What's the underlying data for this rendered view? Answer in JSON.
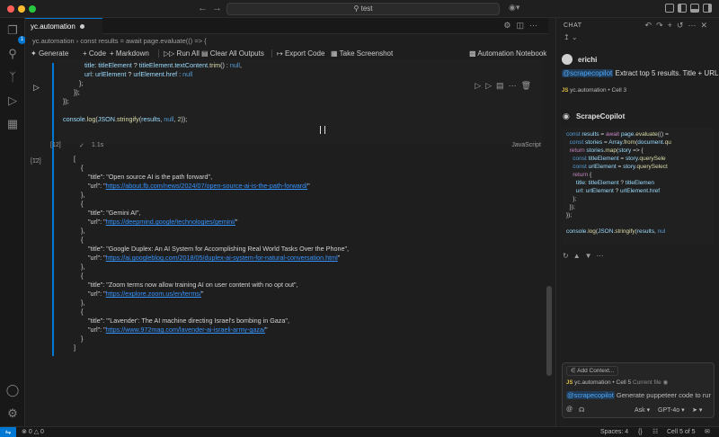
{
  "titlebar": {
    "search_text": "test",
    "colors": {
      "close": "#ff5f57",
      "minimize": "#febc2e",
      "maximize": "#28c840"
    }
  },
  "activity": {
    "items": [
      "explorer-icon",
      "search-icon",
      "source-control-icon",
      "run-debug-icon",
      "extensions-icon"
    ],
    "explorer_badge": "1"
  },
  "editor": {
    "tab": {
      "label": "yc.automation"
    },
    "breadcrumb": [
      "yc.automation",
      "const results = await page.evaluate(() => {"
    ],
    "toolbar": {
      "generate": "Generate",
      "code": "Code",
      "markdown": "Markdown",
      "run_all": "Run All",
      "clear_outputs": "Clear All Outputs",
      "export": "Export Code",
      "screenshot": "Take Screenshot",
      "notebook": "Automation Notebook"
    },
    "code_lines": [
      "title: titleElement ? titleElement.textContent.trim() : null,",
      "url: urlElement ? urlElement.href : null",
      "};",
      "});",
      "});",
      "",
      "console.log(JSON.stringify(results, null, 2));"
    ],
    "cell": {
      "exec_count": "[12]",
      "duration": "1.1s",
      "language": "JavaScript"
    },
    "output": {
      "results": [
        {
          "title": "Open source AI is the path forward",
          "url": "https://about.fb.com/news/2024/07/open-source-ai-is-the-path-forward/"
        },
        {
          "title": "Gemini AI",
          "url": "https://deepmind.google/technologies/gemini/"
        },
        {
          "title": "Google Duplex: An AI System for Accomplishing Real World Tasks Over the Phone",
          "url": "https://ai.googleblog.com/2018/05/duplex-ai-system-for-natural-conversation.html"
        },
        {
          "title": "Zoom terms now allow training AI on user content with no opt out",
          "url": "https://explore.zoom.us/en/terms/"
        },
        {
          "title": "'Lavender': The AI machine directing Israel's bombing in Gaza",
          "url": "https://www.972mag.com/lavender-ai-israeli-army-gaza/"
        }
      ]
    }
  },
  "chat": {
    "header": "CHAT",
    "user": {
      "name": "erichi",
      "mention": "@scrapecopilot",
      "message": "Extract top 5 results. Title + URL",
      "ref_file": "yc.automation",
      "ref_cell": "Cell 3"
    },
    "assistant": {
      "name": "ScrapeCopilot",
      "code_lines": [
        "const results = await page.evaluate(() =",
        "  const stories = Array.from(document.qu",
        "  return stories.map(story => {",
        "    const titleElement = story.querySele",
        "    const urlElement = story.querySelect",
        "    return {",
        "      title: titleElement ? titleElemen",
        "      url: urlElement ? urlElement.href",
        "    };",
        "  });",
        "});",
        "",
        "console.log(JSON.stringify(results, nul"
      ]
    },
    "input": {
      "add_context": "Add Context...",
      "file": "yc.automation",
      "cell": "Cell 5",
      "current_file": "Current file",
      "mention": "@scrapecopilot",
      "prompt": "Generate puppeteer code to rur",
      "mode": "Ask",
      "model": "GPT-4o"
    }
  },
  "statusbar": {
    "errors": "0",
    "warnings": "0",
    "spaces": "Spaces: 4",
    "cell": "Cell 5 of 5"
  }
}
